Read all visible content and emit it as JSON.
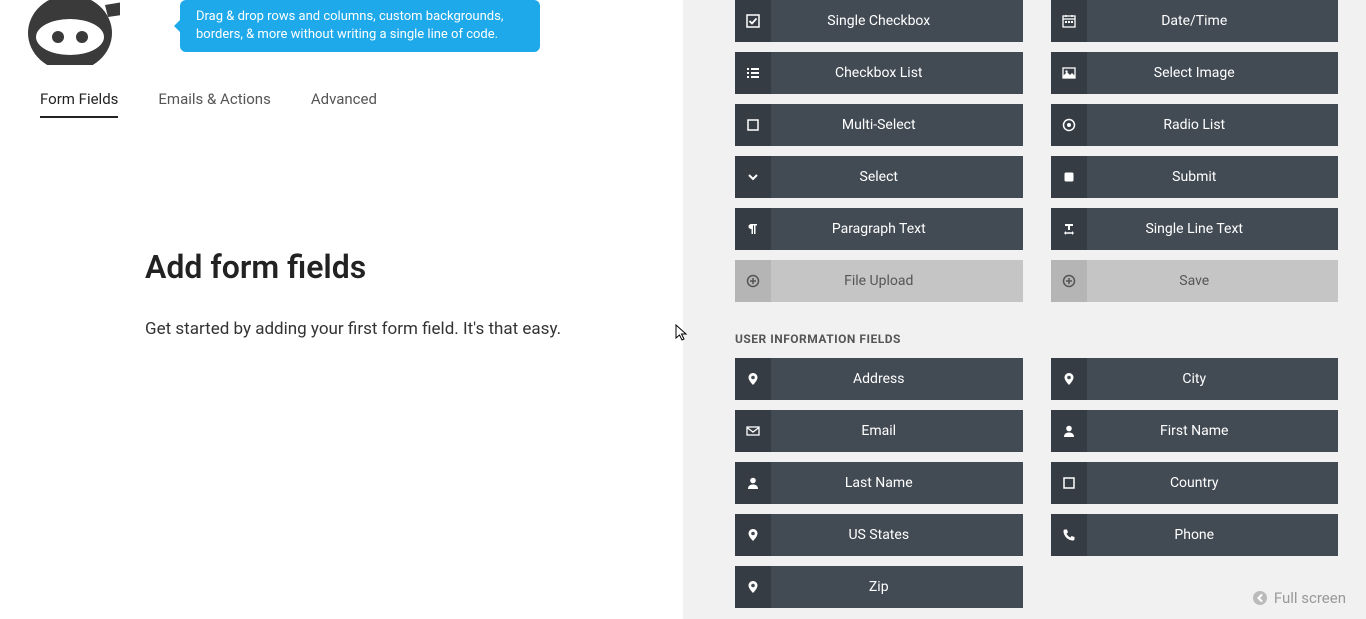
{
  "tooltip": "Drag & drop rows and columns, custom backgrounds, borders, & more without writing a single line of code.",
  "tabs": [
    {
      "label": "Form Fields",
      "active": true
    },
    {
      "label": "Emails & Actions",
      "active": false
    },
    {
      "label": "Advanced",
      "active": false
    }
  ],
  "content": {
    "heading": "Add form fields",
    "paragraph": "Get started by adding your first form field. It's that easy."
  },
  "common_fields": [
    {
      "label": "Single Checkbox",
      "icon": "check-square",
      "disabled": false
    },
    {
      "label": "Date/Time",
      "icon": "calendar",
      "disabled": false
    },
    {
      "label": "Checkbox List",
      "icon": "list",
      "disabled": false
    },
    {
      "label": "Select Image",
      "icon": "image",
      "disabled": false
    },
    {
      "label": "Multi-Select",
      "icon": "square",
      "disabled": false
    },
    {
      "label": "Radio List",
      "icon": "dot-circle",
      "disabled": false
    },
    {
      "label": "Select",
      "icon": "chevron-down",
      "disabled": false
    },
    {
      "label": "Submit",
      "icon": "square-filled",
      "disabled": false
    },
    {
      "label": "Paragraph Text",
      "icon": "paragraph",
      "disabled": false
    },
    {
      "label": "Single Line Text",
      "icon": "text-width",
      "disabled": false
    },
    {
      "label": "File Upload",
      "icon": "plus-circle",
      "disabled": true
    },
    {
      "label": "Save",
      "icon": "plus-circle",
      "disabled": true
    }
  ],
  "user_section_title": "USER INFORMATION FIELDS",
  "user_fields": [
    {
      "label": "Address",
      "icon": "map-marker",
      "disabled": false
    },
    {
      "label": "City",
      "icon": "map-marker",
      "disabled": false
    },
    {
      "label": "Email",
      "icon": "envelope",
      "disabled": false
    },
    {
      "label": "First Name",
      "icon": "user",
      "disabled": false
    },
    {
      "label": "Last Name",
      "icon": "user",
      "disabled": false
    },
    {
      "label": "Country",
      "icon": "square",
      "disabled": false
    },
    {
      "label": "US States",
      "icon": "map-marker",
      "disabled": false
    },
    {
      "label": "Phone",
      "icon": "phone",
      "disabled": false
    },
    {
      "label": "Zip",
      "icon": "map-marker",
      "disabled": false
    }
  ],
  "fullscreen_label": "Full screen"
}
